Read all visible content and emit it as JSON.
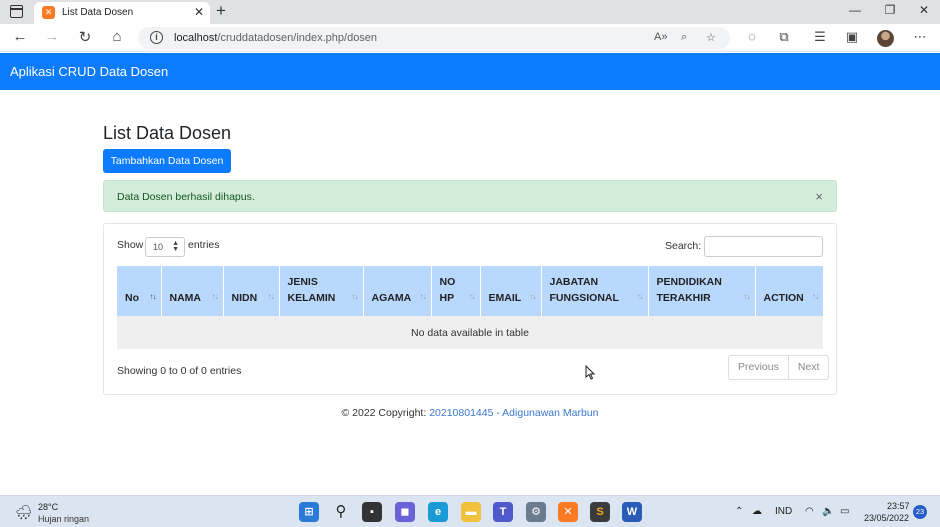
{
  "browser": {
    "tab_title": "List Data Dosen",
    "tab_close": "✕",
    "new_tab": "+",
    "url_host": "localhost",
    "url_path": "/cruddatadosen/index.php/dosen"
  },
  "app": {
    "brand": "Aplikasi CRUD Data Dosen",
    "page_title": "List Data Dosen",
    "add_button": "Tambahkan Data Dosen",
    "alert_text": "Data Dosen berhasil dihapus.",
    "alert_close": "×"
  },
  "datatable": {
    "show_label": "Show",
    "length_value": "10",
    "entries_label": "entries",
    "search_label": "Search:",
    "columns": [
      {
        "line1": "",
        "line2": "No"
      },
      {
        "line1": "",
        "line2": "NAMA"
      },
      {
        "line1": "",
        "line2": "NIDN"
      },
      {
        "line1": "JENIS",
        "line2": "KELAMIN"
      },
      {
        "line1": "",
        "line2": "AGAMA"
      },
      {
        "line1": "NO",
        "line2": "HP"
      },
      {
        "line1": "",
        "line2": "EMAIL"
      },
      {
        "line1": "JABATAN",
        "line2": "FUNGSIONAL"
      },
      {
        "line1": "PENDIDIKAN",
        "line2": "TERAKHIR"
      },
      {
        "line1": "",
        "line2": "ACTION"
      }
    ],
    "empty_text": "No data available in table",
    "info_text": "Showing 0 to 0 of 0 entries",
    "prev_label": "Previous",
    "next_label": "Next"
  },
  "footer": {
    "prefix": "© 2022 Copyright: ",
    "link_text": "20210801445 - Adigunawan Marbun"
  },
  "taskbar": {
    "temp": "28°C",
    "condition": "Hujan ringan",
    "lang": "IND",
    "time": "23:57",
    "date": "23/05/2022",
    "notifications": "23"
  },
  "colors": {
    "navbar": "#0d7bfd",
    "table_header": "#b8d9fd",
    "alert_bg": "#d4edda",
    "link": "#3a78cf"
  }
}
